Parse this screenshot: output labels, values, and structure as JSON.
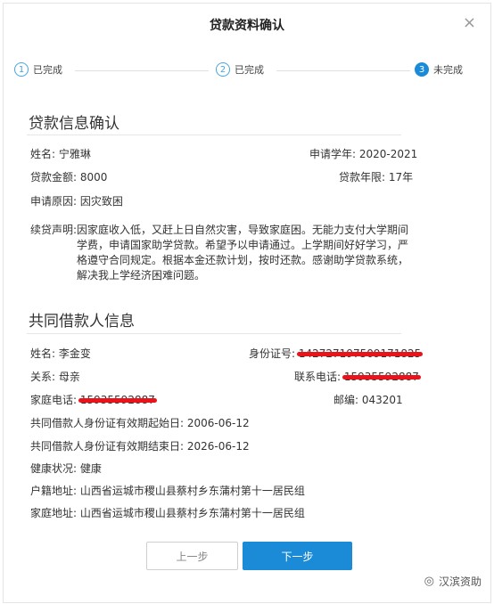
{
  "dialog": {
    "title": "贷款资料确认",
    "close_icon": "×"
  },
  "steps": [
    {
      "num": "1",
      "label": "已完成"
    },
    {
      "num": "2",
      "label": "已完成"
    },
    {
      "num": "3",
      "label": "未完成"
    }
  ],
  "loan_info": {
    "title": "贷款信息确认",
    "name_label": "姓名:",
    "name_value": "宁雅琳",
    "year_label": "申请学年:",
    "year_value": "2020-2021",
    "amount_label": "贷款金额:",
    "amount_value": "8000",
    "term_label": "贷款年限:",
    "term_value": "17年",
    "reason_label": "申请原因:",
    "reason_value": "因灾致困",
    "statement_label": "续贷声明:",
    "statement_value": "因家庭收入低，又赶上日自然灾害，导致家庭困。无能力支付大学期间学费，申请国家助学贷款。希望予以申请通过。上学期间好好学习，严格遵守合同规定。根据本金还款计划，按时还款。感谢助学贷款系统，解决我上学经济困难问题。"
  },
  "co_borrower": {
    "title": "共同借款人信息",
    "name_label": "姓名:",
    "name_value": "李金变",
    "id_label": "身份证号:",
    "id_value": "142727197509171825",
    "relation_label": "关系:",
    "relation_value": "母亲",
    "phone_label": "联系电话:",
    "phone_value": "15935592887",
    "home_phone_label": "家庭电话:",
    "home_phone_value": "15935592887",
    "postcode_label": "邮编:",
    "postcode_value": "043201",
    "id_start_label": "共同借款人身份证有效期起始日:",
    "id_start_value": "2006-06-12",
    "id_end_label": "共同借款人身份证有效期结束日:",
    "id_end_value": "2026-06-12",
    "health_label": "健康状况:",
    "health_value": "健康",
    "household_label": "户籍地址:",
    "household_value": "山西省运城市稷山县蔡村乡东蒲村第十一居民组",
    "home_addr_label": "家庭地址:",
    "home_addr_value": "山西省运城市稷山县蔡村乡东蒲村第十一居民组"
  },
  "buttons": {
    "prev": "上一步",
    "next": "下一步"
  },
  "watermark": {
    "icon": "wechat-icon",
    "text": "汉滨资助"
  },
  "colors": {
    "accent": "#1b8bd8",
    "redaction": "#e8131b"
  }
}
